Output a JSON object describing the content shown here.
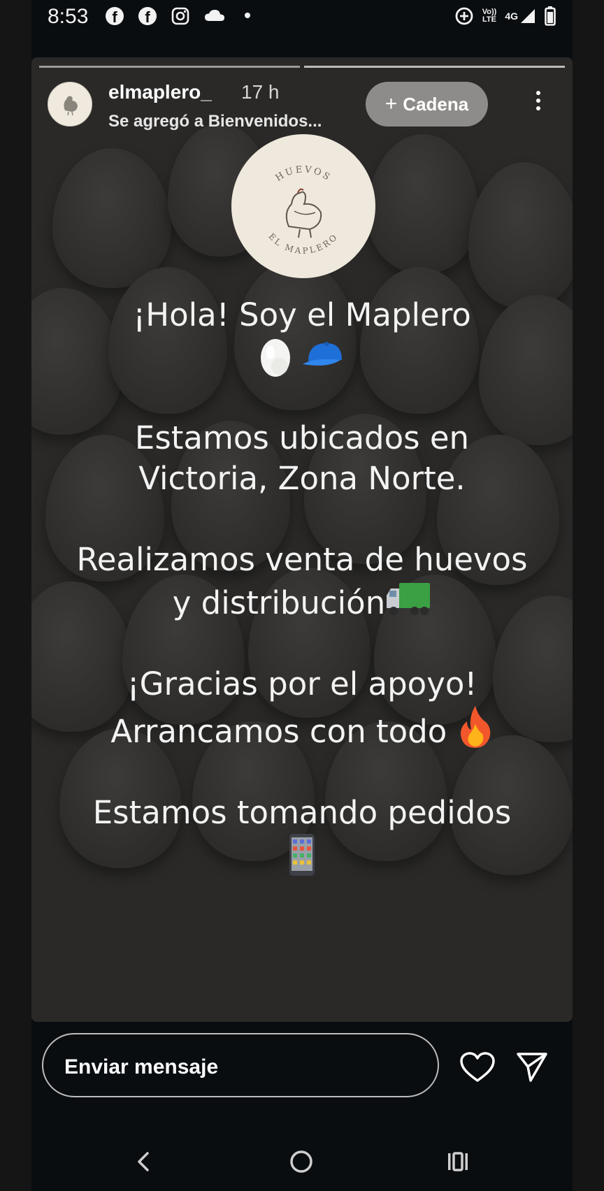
{
  "status_bar": {
    "time": "8:53",
    "left_icons": [
      "facebook-icon",
      "facebook-icon",
      "instagram-icon",
      "cloud-icon",
      "dot"
    ],
    "right": {
      "volte_top": "Vo))",
      "volte_bottom": "LTE",
      "network": "4G"
    }
  },
  "story": {
    "username": "elmaplero_",
    "time_ago": "17 h",
    "subtitle": "Se agregó a Bienvenidos...",
    "chain_button": "Cadena",
    "chain_plus": "+",
    "logo_text_top": "HUEVOS",
    "logo_text_bottom": "EL MAPLERO",
    "lines": {
      "greeting": "¡Hola! Soy el Maplero",
      "location_1": "Estamos ubicados en",
      "location_2": "Victoria, Zona Norte.",
      "sales_1": "Realizamos venta de huevos",
      "sales_2": "y distribución",
      "thanks_1": "¡Gracias por el apoyo!",
      "thanks_2": "Arrancamos con todo",
      "orders": "Estamos tomando pedidos"
    },
    "emojis": [
      "egg-icon",
      "cap-icon",
      "truck-icon",
      "fire-icon",
      "phone-icon"
    ],
    "progress_segments": 2
  },
  "reply": {
    "placeholder": "Enviar mensaje"
  },
  "colors": {
    "story_bg": "#2a2928",
    "chain_button": "#8e8c8a",
    "logo_bg": "#efe8dc"
  }
}
